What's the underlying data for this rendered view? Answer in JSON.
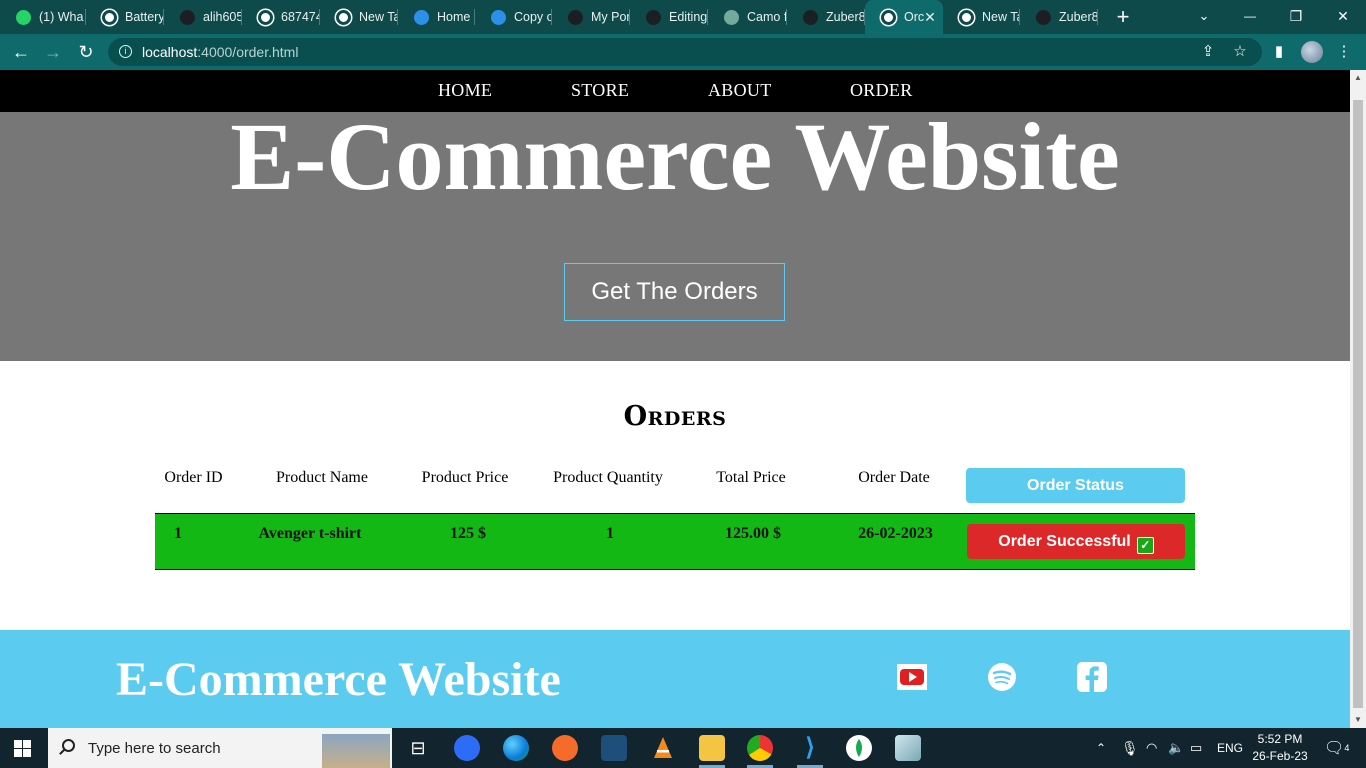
{
  "browser": {
    "tabs": [
      {
        "label": "(1) Wha",
        "icon": "whatsapp-icon",
        "color": "#25d366"
      },
      {
        "label": "Battery",
        "icon": "globe-icon",
        "color": "#ffffff"
      },
      {
        "label": "alih605",
        "icon": "github-icon",
        "color": "#1b1f23"
      },
      {
        "label": "687474",
        "icon": "globe-icon",
        "color": "#ffffff"
      },
      {
        "label": "New Ta",
        "icon": "chrome-icon",
        "color": "#ffffff"
      },
      {
        "label": "Home",
        "icon": "canva-icon",
        "color": "#2c8fe8"
      },
      {
        "label": "Copy o",
        "icon": "canva-icon",
        "color": "#2c8fe8"
      },
      {
        "label": "My Por",
        "icon": "code-icon",
        "color": "#1b1f23"
      },
      {
        "label": "Editing",
        "icon": "github-icon",
        "color": "#1b1f23"
      },
      {
        "label": "Camo f",
        "icon": "openai-icon",
        "color": "#74aa9c"
      },
      {
        "label": "Zuber8",
        "icon": "github-icon",
        "color": "#1b1f23"
      },
      {
        "label": "Orc",
        "icon": "globe-icon",
        "color": "#ffffff",
        "active": true
      },
      {
        "label": "New Ta",
        "icon": "chrome-icon",
        "color": "#ffffff"
      },
      {
        "label": "Zuber8",
        "icon": "github-icon",
        "color": "#1b1f23"
      }
    ],
    "active_tab_close": "✕",
    "new_tab": "+",
    "window_controls": {
      "dropdown": "⌄",
      "minimize": "—",
      "restore": "❐",
      "close": "✕"
    },
    "url_host": "localhost",
    "url_path": ":4000/order.html"
  },
  "site": {
    "nav": [
      "HOME",
      "STORE",
      "ABOUT",
      "ORDER"
    ],
    "hero_title": "E-Commerce Website",
    "get_orders_button": "Get The Orders",
    "orders_heading": "Orders",
    "table": {
      "headers": [
        "Order ID",
        "Product Name",
        "Product Price",
        "Product Quantity",
        "Total Price",
        "Order Date"
      ],
      "status_header": "Order Status",
      "rows": [
        {
          "order_id": "1",
          "product_name": "Avenger t-shirt",
          "product_price": "125 $",
          "quantity": "1",
          "total_price": "125.00 $",
          "order_date": "26-02-2023",
          "status": "Order Successful",
          "status_check": "✓"
        }
      ]
    },
    "footer_title": "E-Commerce Website",
    "social": [
      "youtube-icon",
      "spotify-icon",
      "facebook-icon"
    ],
    "colors": {
      "accent": "#5bcbf0",
      "success_row": "#14b814",
      "status_red": "#dc2828",
      "hero_bg": "#777777"
    }
  },
  "taskbar": {
    "search_placeholder": "Type here to search",
    "language": "ENG",
    "time": "5:52 PM",
    "date": "26-Feb-23",
    "notification_count": "4"
  }
}
